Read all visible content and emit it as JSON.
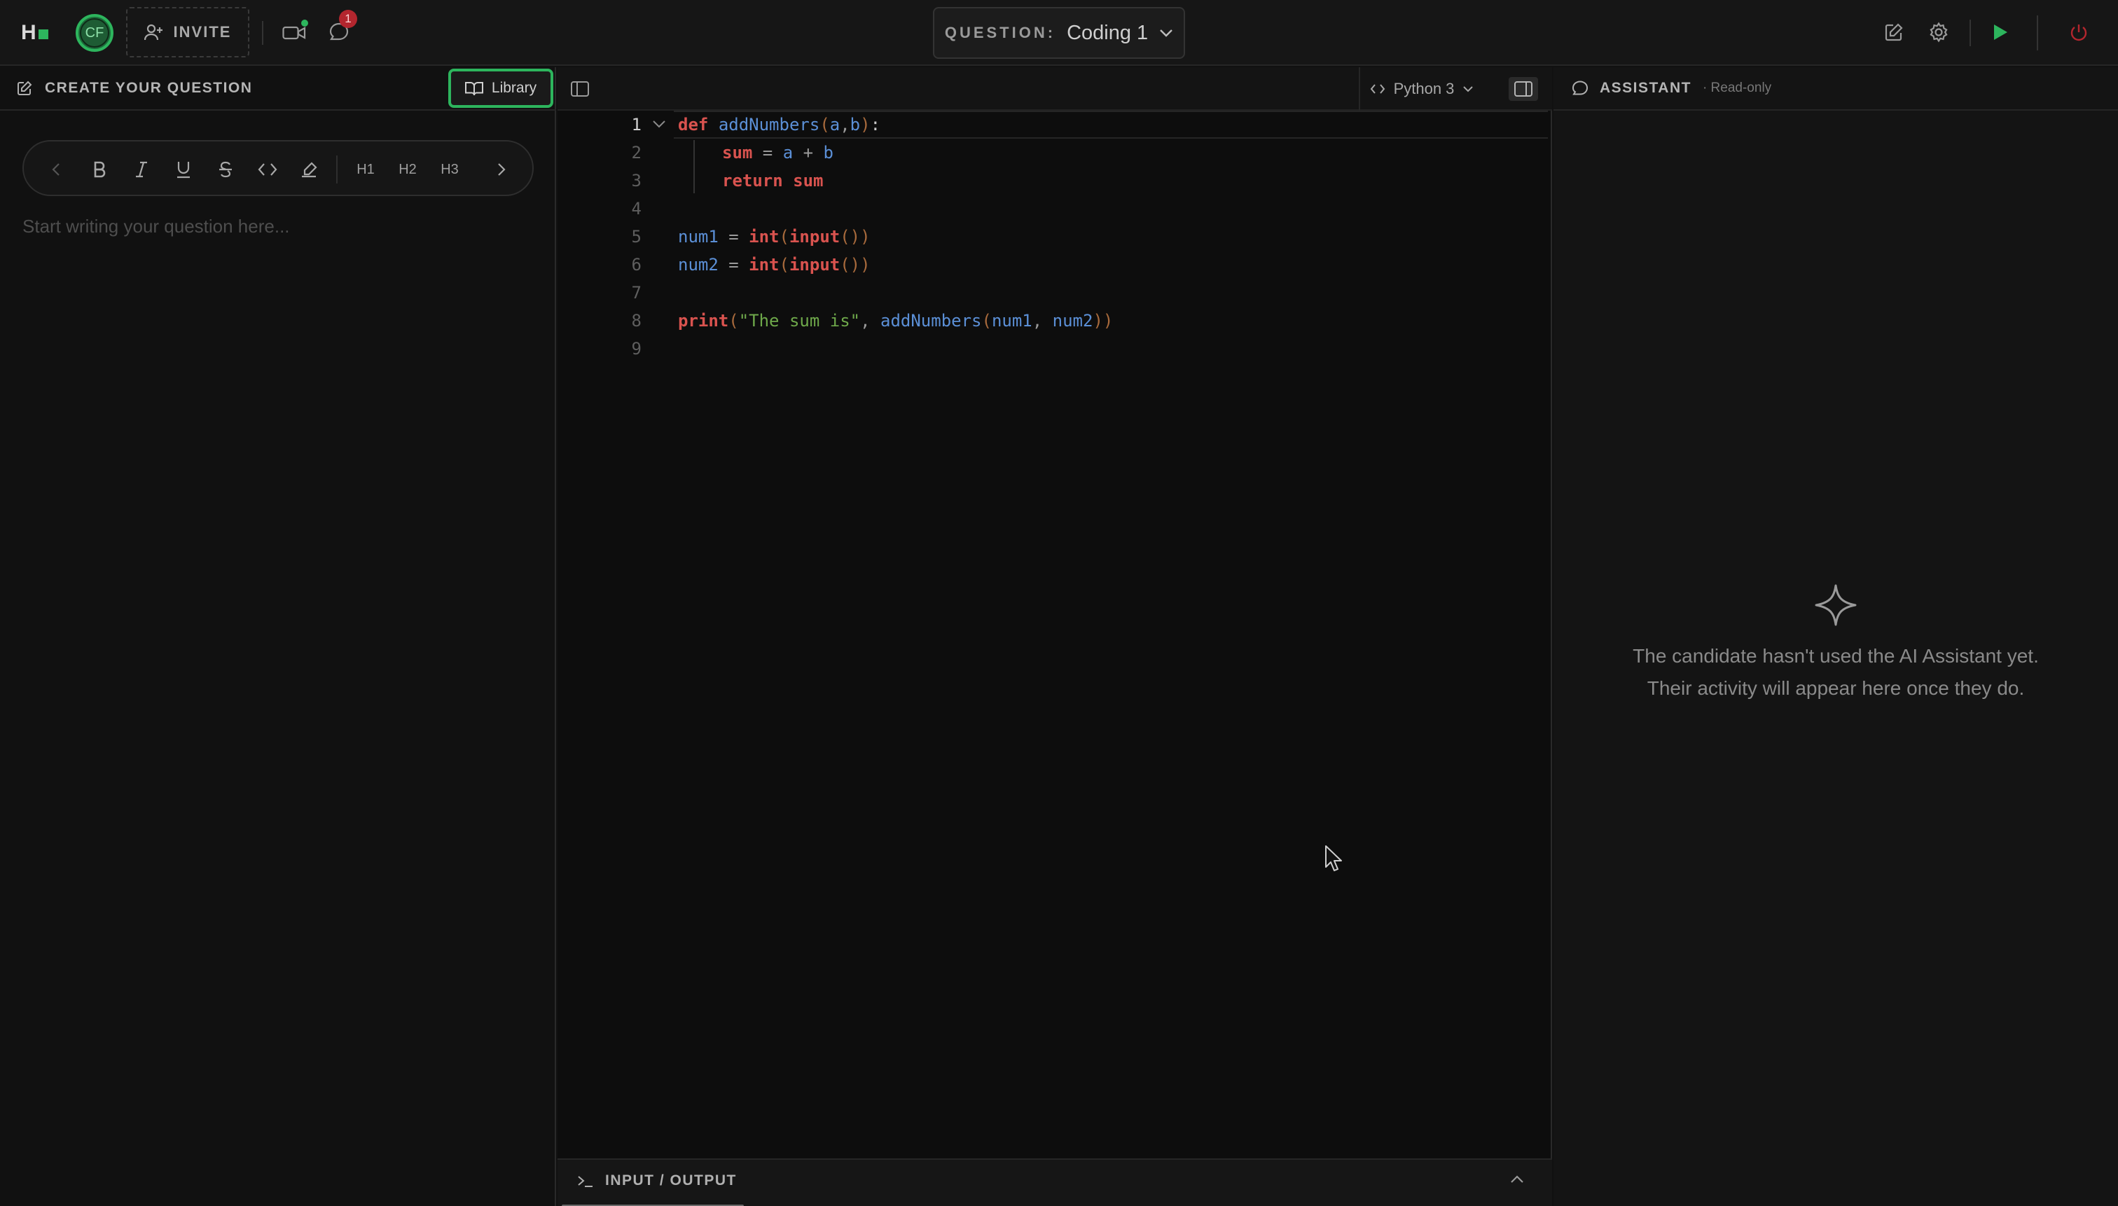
{
  "topbar": {
    "logo": "H",
    "avatar_initials": "CF",
    "invite_label": "INVITE",
    "notification_count": "1",
    "question_label": "QUESTION:",
    "question_value": "Coding 1"
  },
  "left_panel": {
    "title": "CREATE YOUR QUESTION",
    "library_label": "Library",
    "toolbar": {
      "h1": "H1",
      "h2": "H2",
      "h3": "H3"
    },
    "placeholder": "Start writing your question here..."
  },
  "editor": {
    "language": "Python 3",
    "lines": [
      "1",
      "2",
      "3",
      "4",
      "5",
      "6",
      "7",
      "8",
      "9"
    ],
    "code": {
      "l1": {
        "kw": "def",
        "fn": "addNumbers",
        "p1": "(",
        "a": "a",
        "c": ",",
        "b": "b",
        "p2": ")",
        "colon": ":"
      },
      "l2": {
        "kw": "sum",
        "eq": " = ",
        "a": "a",
        "plus": " + ",
        "b": "b"
      },
      "l3": {
        "kw": "return",
        "v": "sum"
      },
      "l5": {
        "id": "num1",
        "eq": " = ",
        "fn": "int",
        "p1": "(",
        "fn2": "input",
        "p2": "())"
      },
      "l6": {
        "id": "num2",
        "eq": " = ",
        "fn": "int",
        "p1": "(",
        "fn2": "input",
        "p2": "())"
      },
      "l8": {
        "fn": "print",
        "p1": "(",
        "str": "\"The sum is\"",
        "c": ", ",
        "fn2": "addNumbers",
        "p2": "(",
        "a": "num1",
        "c2": ", ",
        "b": "num2",
        "p3": "))"
      }
    },
    "io_label": "INPUT / OUTPUT"
  },
  "assistant": {
    "title": "ASSISTANT",
    "subtitle": "· Read-only",
    "empty_line1": "The candidate hasn't used the AI Assistant yet.",
    "empty_line2": "Their activity will appear here once they do."
  },
  "colors": {
    "accent": "#2db55d",
    "badge": "#b3262e",
    "keyword": "#d9534f",
    "identifier": "#5b8fd6",
    "string": "#6ea84a"
  }
}
